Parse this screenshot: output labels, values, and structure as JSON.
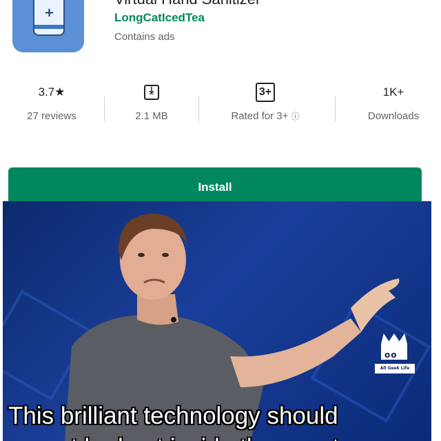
{
  "app": {
    "title": "Virtual Hand Sanitizer",
    "developer": "LongCatIcedTea",
    "contains_ads": "Contains ads",
    "icon_name": "hand-sanitizer-bottle-icon"
  },
  "stats": {
    "rating": {
      "value": "3.7★",
      "label": "27 reviews"
    },
    "size": {
      "label": "2.1 MB",
      "icon_name": "download-icon",
      "icon_glyph": "⤓"
    },
    "content_rating": {
      "badge": "3+",
      "label": "Rated for 3+",
      "info_glyph": "ⓘ"
    },
    "downloads": {
      "value": "1K+",
      "label": "Downloads"
    }
  },
  "install": {
    "label": "Install",
    "color": "#01875f"
  },
  "meme": {
    "caption": "This brilliant technology should",
    "caption_cut": "not be kept inside the country",
    "watermark": "All Geek Life"
  }
}
